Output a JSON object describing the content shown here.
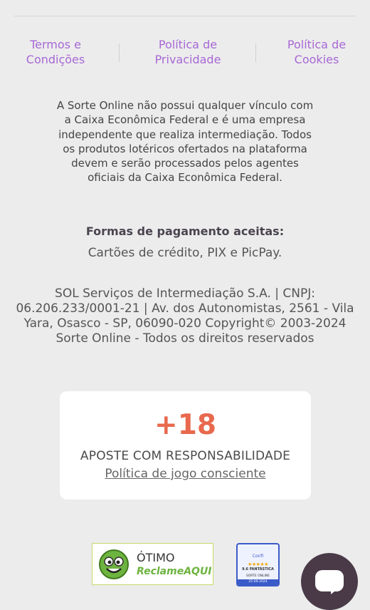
{
  "footer_links": [
    {
      "label": "Termos e\nCondições"
    },
    {
      "label": "Política de\nPrivacidade"
    },
    {
      "label": "Política de\nCookies"
    }
  ],
  "disclaimer": "A Sorte Online não possui qualquer vínculo com a Caixa Econômica Federal e é uma empresa independente que realiza intermediação. Todos os produtos lotéricos ofertados na plataforma devem e serão processados pelos agentes oficiais da Caixa Econômica Federal.",
  "payment": {
    "title": "Formas de pagamento aceitas:",
    "methods": "Cartões de crédito, PIX e PicPay."
  },
  "company_info": "SOL Serviços de Intermediação S.A. | CNPJ: 06.206.233/0001-21 | Av. dos Autonomistas, 2561 - Vila Yara, Osasco - SP, 06090-020 Copyright© 2003-2024 Sorte Online - Todos os direitos reservados",
  "responsible": {
    "age": "+18",
    "headline": "APOSTE COM RESPONSABILIDADE",
    "link": "Política de jogo consciente"
  },
  "badges": {
    "reclame_aqui": {
      "rating": "ÓTIMO",
      "brand": "ReclameAQUI",
      "color": "#6db33f"
    },
    "confi": {
      "name": "Confi",
      "stars": "★★★★★",
      "score": "9.6 FANTÁSTICA",
      "site": "SORTE ONLINE",
      "date": "25-09-2024",
      "color": "#3b5bc9"
    }
  },
  "chat_button": {
    "icon": "chat-bubble-icon",
    "color": "#4a3a48"
  }
}
